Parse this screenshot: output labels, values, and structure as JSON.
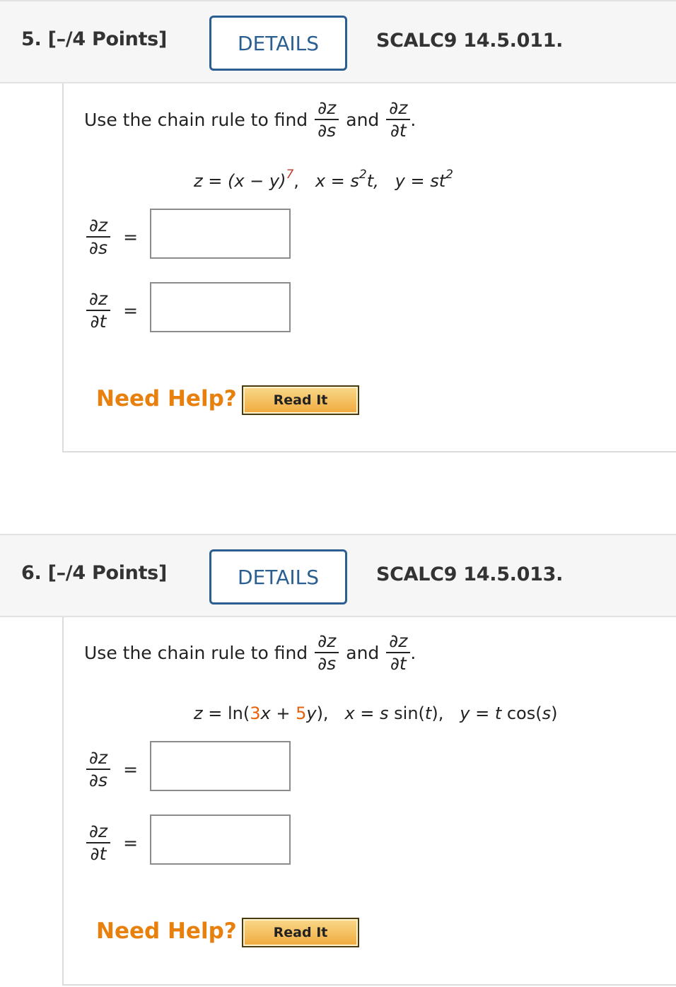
{
  "questions": [
    {
      "number": "5.",
      "points": "[–/4 Points]",
      "details_label": "DETAILS",
      "code": "SCALC9 14.5.011.",
      "prompt_text": "Use the chain rule to find",
      "and_text": "and",
      "period": ".",
      "partial_z": "∂z",
      "partial_s": "∂s",
      "partial_t": "∂t",
      "equation": {
        "z_part": "z = (x − y)",
        "z_exp": "7",
        "x_part": "x = s",
        "x_exp": "2",
        "x_tail": "t,",
        "y_part": "y = st",
        "y_exp": "2"
      },
      "answers": [
        {
          "label_num": "∂z",
          "label_den": "∂s",
          "equals": "=",
          "value": ""
        },
        {
          "label_num": "∂z",
          "label_den": "∂t",
          "equals": "=",
          "value": ""
        }
      ],
      "need_help": "Need Help?",
      "read_it": "Read It"
    },
    {
      "number": "6.",
      "points": "[–/4 Points]",
      "details_label": "DETAILS",
      "code": "SCALC9 14.5.013.",
      "prompt_text": "Use the chain rule to find",
      "and_text": "and",
      "period": ".",
      "partial_z": "∂z",
      "partial_s": "∂s",
      "partial_t": "∂t",
      "equation": {
        "z_pre": "z = ln(",
        "coef1": "3",
        "mid": "x + ",
        "coef2": "5",
        "z_post": "y),",
        "x_eq": "x = s sin(t),",
        "y_eq": "y = t cos(s)"
      },
      "answers": [
        {
          "label_num": "∂z",
          "label_den": "∂s",
          "equals": "=",
          "value": ""
        },
        {
          "label_num": "∂z",
          "label_den": "∂t",
          "equals": "=",
          "value": ""
        }
      ],
      "need_help": "Need Help?",
      "read_it": "Read It"
    }
  ],
  "colors": {
    "details_border": "#2b5f91",
    "highlight_red": "#c0392b",
    "highlight_orange": "#e8620b",
    "help_orange": "#e8800e",
    "header_bg": "#f6f6f6"
  }
}
